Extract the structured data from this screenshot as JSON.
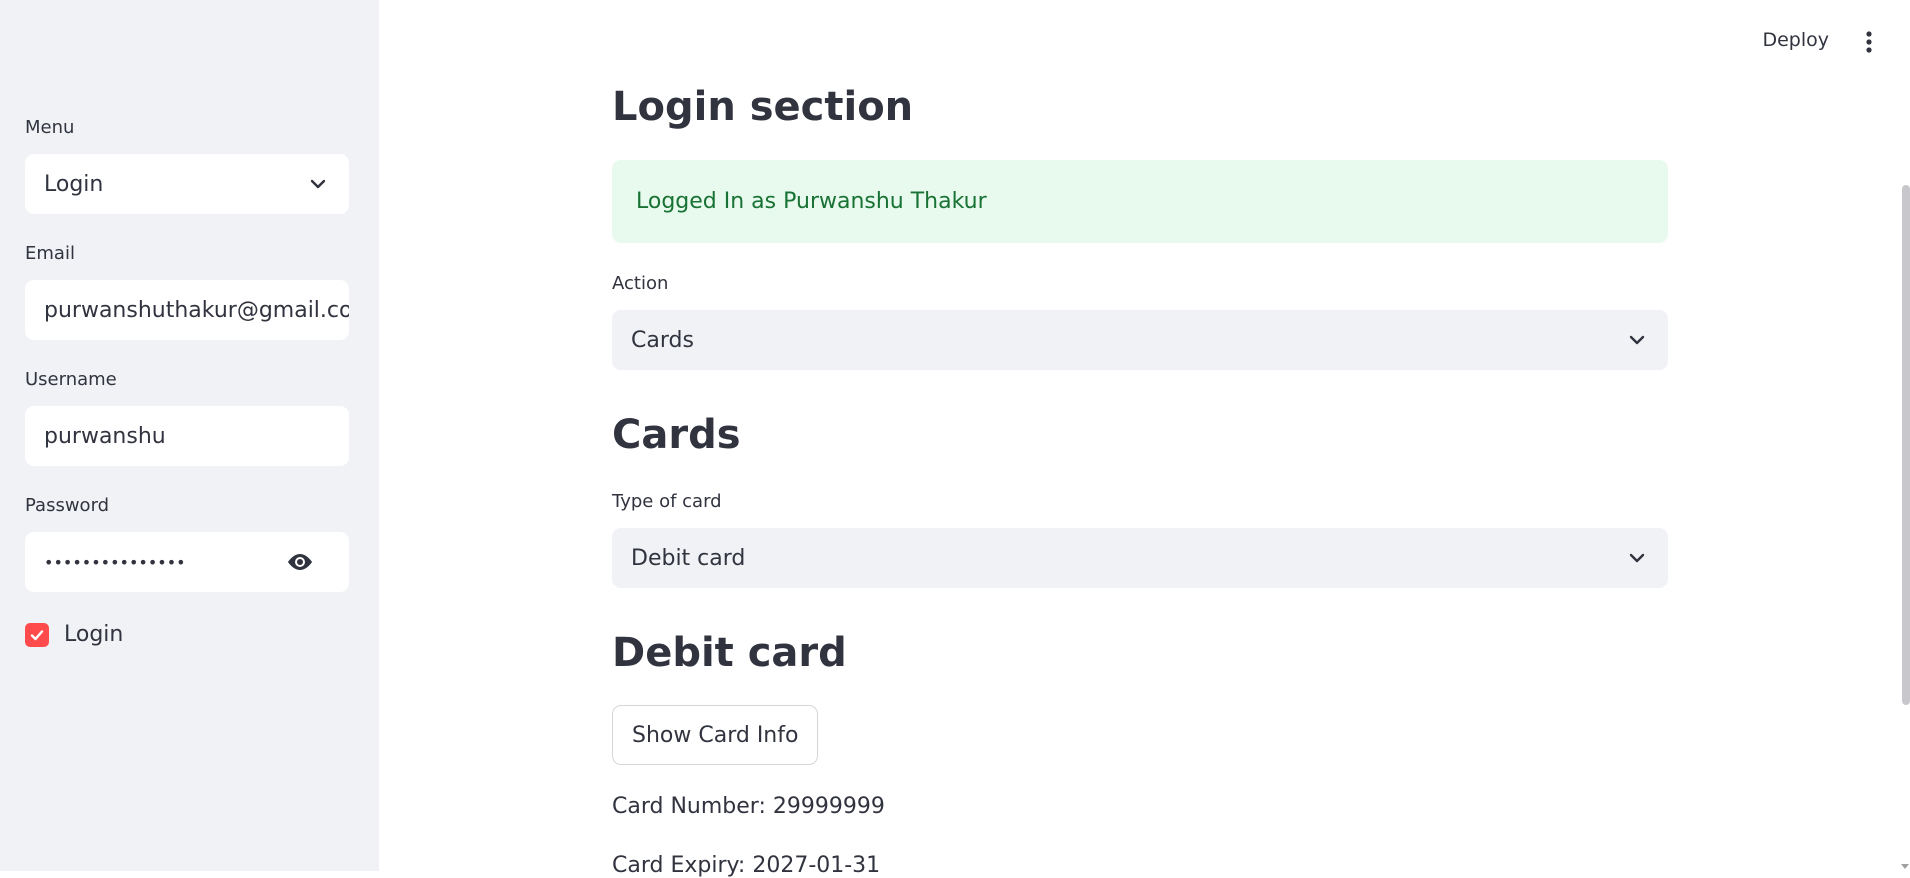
{
  "header": {
    "deploy_label": "Deploy"
  },
  "sidebar": {
    "menu_label": "Menu",
    "menu_value": "Login",
    "email_label": "Email",
    "email_value": "purwanshuthakur@gmail.com",
    "username_label": "Username",
    "username_value": "purwanshu",
    "password_label": "Password",
    "password_value": "•••••••••••••••",
    "login_checkbox_label": "Login",
    "login_checked": true
  },
  "main": {
    "title": "Login section",
    "alert_text": "Logged In as Purwanshu Thakur",
    "action_label": "Action",
    "action_value": "Cards",
    "cards_heading": "Cards",
    "card_type_label": "Type of card",
    "card_type_value": "Debit card",
    "debit_heading": "Debit card",
    "show_button": "Show Card Info",
    "card_number": "Card Number: 29999999",
    "card_expiry": "Card Expiry: 2027-01-31"
  },
  "colors": {
    "accent": "#ff4b4b",
    "success_bg": "#e8f9ee",
    "success_text": "#177233",
    "sidebar_bg": "#f0f2f6"
  }
}
